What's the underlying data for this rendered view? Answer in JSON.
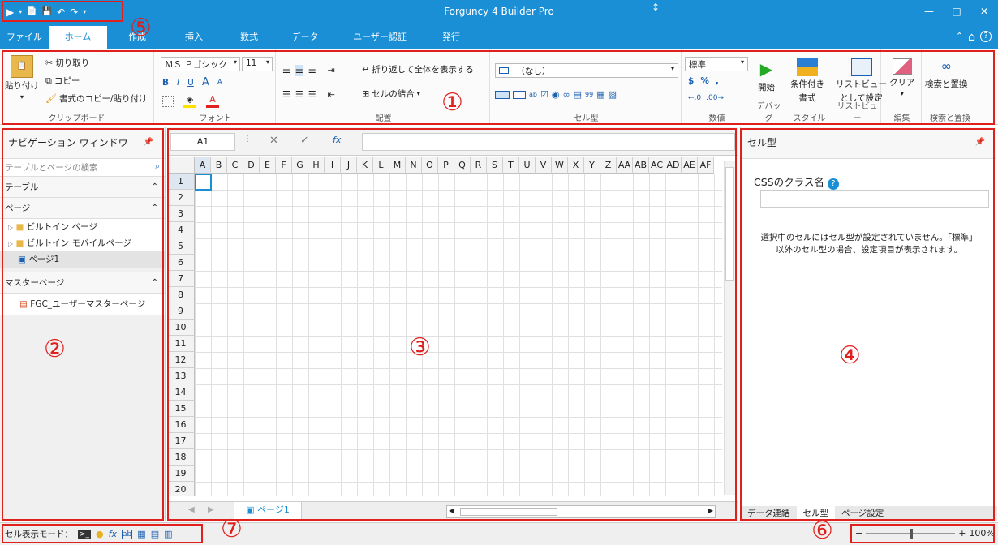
{
  "app": {
    "title": "Forguncy 4 Builder Pro"
  },
  "qat": {
    "icons": [
      "▶",
      "▾",
      "📄",
      "💾",
      "↶",
      "↷",
      "▾"
    ]
  },
  "window": {
    "min": "—",
    "max": "□",
    "close": "✕"
  },
  "tabs": [
    {
      "label": "ファイル"
    },
    {
      "label": "ホーム"
    },
    {
      "label": "作成"
    },
    {
      "label": "挿入"
    },
    {
      "label": "数式"
    },
    {
      "label": "データ"
    },
    {
      "label": "ユーザー認証"
    },
    {
      "label": "発行"
    }
  ],
  "tab_right": {
    "collapse": "⌃",
    "home": "⌂",
    "help": "?"
  },
  "ribbon": {
    "clipboard": {
      "paste": "貼り付け",
      "cut": "切り取り",
      "copy": "コピー",
      "format_copy": "書式のコピー/貼り付け",
      "label": "クリップボード"
    },
    "font": {
      "name": "ＭＳ Ｐゴシック",
      "size": "11",
      "bold": "B",
      "italic": "I",
      "underline": "U",
      "grow": "A",
      "shrink": "A",
      "label": "フォント"
    },
    "align": {
      "wrap": "折り返して全体を表示する",
      "merge": "セルの結合",
      "label": "配置"
    },
    "celltype": {
      "value": "（なし）",
      "label": "セル型"
    },
    "number": {
      "format": "標準",
      "currency": "$",
      "percent": "%",
      "comma": ",",
      "label": "数値"
    },
    "debug": {
      "start": "開始",
      "label": "デバッグ"
    },
    "style": {
      "cond_format_1": "条件付き",
      "cond_format_2": "書式",
      "label": "スタイル"
    },
    "listview": {
      "set_1": "リストビュー",
      "set_2": "として設定",
      "label": "リストビュー"
    },
    "edit": {
      "clear": "クリア",
      "label": "編集"
    },
    "search": {
      "find_replace": "検索と置換",
      "label": "検索と置換"
    }
  },
  "nav": {
    "title": "ナビゲーション ウィンドウ",
    "search_placeholder": "テーブルとページの検索",
    "tables_label": "テーブル",
    "pages_label": "ページ",
    "pages": [
      "ビルトイン ページ",
      "ビルトイン モバイルページ",
      "ページ1"
    ],
    "master_label": "マスターページ",
    "masters": [
      "FGC_ユーザーマスターページ"
    ]
  },
  "sheet": {
    "cell_ref": "A1",
    "cancel": "✕",
    "confirm": "✓",
    "fx": "fx",
    "columns": [
      "A",
      "B",
      "C",
      "D",
      "E",
      "F",
      "G",
      "H",
      "I",
      "J",
      "K",
      "L",
      "M",
      "N",
      "O",
      "P",
      "Q",
      "R",
      "S",
      "T",
      "U",
      "V",
      "W",
      "X",
      "Y",
      "Z",
      "AA",
      "AB",
      "AC",
      "AD",
      "AE",
      "AF"
    ],
    "rows": [
      "1",
      "2",
      "3",
      "4",
      "5",
      "6",
      "7",
      "8",
      "9",
      "10",
      "11",
      "12",
      "13",
      "14",
      "15",
      "16",
      "17",
      "18",
      "19",
      "20"
    ],
    "tab": "ページ1"
  },
  "props": {
    "title": "セル型",
    "css_label": "CSSのクラス名",
    "message_1": "選択中のセルにはセル型が設定されていません。「標準」",
    "message_2": "以外のセル型の場合、設定項目が表示されます。",
    "tabs": [
      "データ連結",
      "セル型",
      "ページ設定"
    ]
  },
  "status": {
    "mode_label": "セル表示モード：",
    "zoom": "100%"
  },
  "callouts": [
    "①",
    "②",
    "③",
    "④",
    "⑤",
    "⑥",
    "⑦"
  ],
  "colors": {
    "accent": "#1a8fd6",
    "annotation": "#e0201c"
  }
}
